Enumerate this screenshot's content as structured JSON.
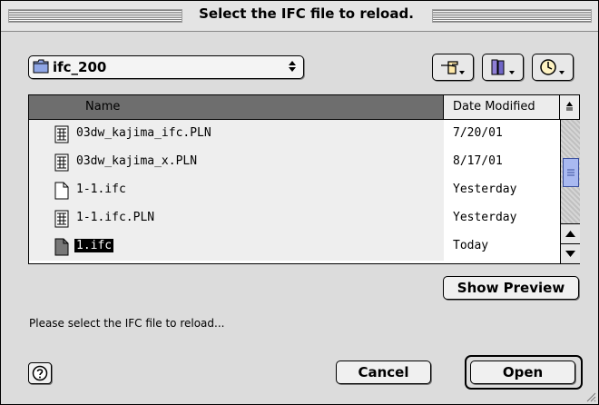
{
  "window": {
    "title": "Select the IFC file to reload."
  },
  "location": {
    "folder": "ifc_200"
  },
  "toolbar": {
    "icons": [
      "pointing-hand-icon",
      "books-icon",
      "clock-icon"
    ]
  },
  "list": {
    "columns": [
      "Name",
      "Date Modified"
    ],
    "rows": [
      {
        "name": "03dw_kajima_ifc.PLN",
        "date": "7/20/01",
        "icon": "plan-file-icon"
      },
      {
        "name": "03dw_kajima_x.PLN",
        "date": "8/17/01",
        "icon": "plan-file-icon"
      },
      {
        "name": "1-1.ifc",
        "date": "Yesterday",
        "icon": "document-icon"
      },
      {
        "name": "1-1.ifc.PLN",
        "date": "Yesterday",
        "icon": "plan-file-icon"
      },
      {
        "name": "1.ifc",
        "date": "Today",
        "icon": "document-icon"
      }
    ],
    "selected_index": 4
  },
  "buttons": {
    "show_preview": "Show Preview",
    "cancel": "Cancel",
    "open": "Open"
  },
  "status_text": "Please select the IFC file to reload...",
  "colors": {
    "accent": "#a9b9f0",
    "selection": "#000000"
  }
}
